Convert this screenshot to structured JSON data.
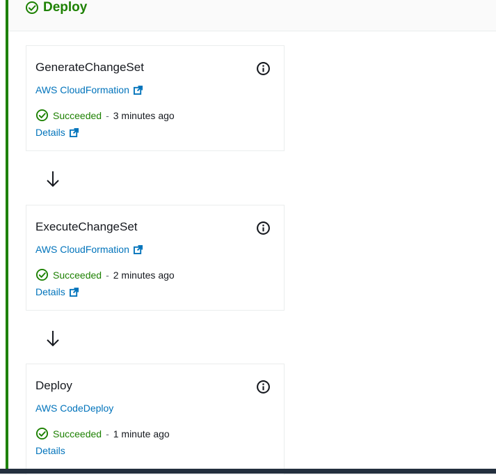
{
  "stage": {
    "title": "Deploy",
    "status_color": "#1d8102",
    "icon": "check-circle-icon"
  },
  "actions": [
    {
      "name": "GenerateChangeSet",
      "provider": "AWS CloudFormation",
      "provider_has_external_link": true,
      "status": "Succeeded",
      "separator": "-",
      "time": "3 minutes ago",
      "details_label": "Details",
      "details_has_external_link": true
    },
    {
      "name": "ExecuteChangeSet",
      "provider": "AWS CloudFormation",
      "provider_has_external_link": true,
      "status": "Succeeded",
      "separator": "-",
      "time": "2 minutes ago",
      "details_label": "Details",
      "details_has_external_link": true
    },
    {
      "name": "Deploy",
      "provider": "AWS CodeDeploy",
      "provider_has_external_link": false,
      "status": "Succeeded",
      "separator": "-",
      "time": "1 minute ago",
      "details_label": "Details",
      "details_has_external_link": false
    }
  ],
  "colors": {
    "link": "#0073bb",
    "success": "#1d8102",
    "text": "#16191f"
  }
}
